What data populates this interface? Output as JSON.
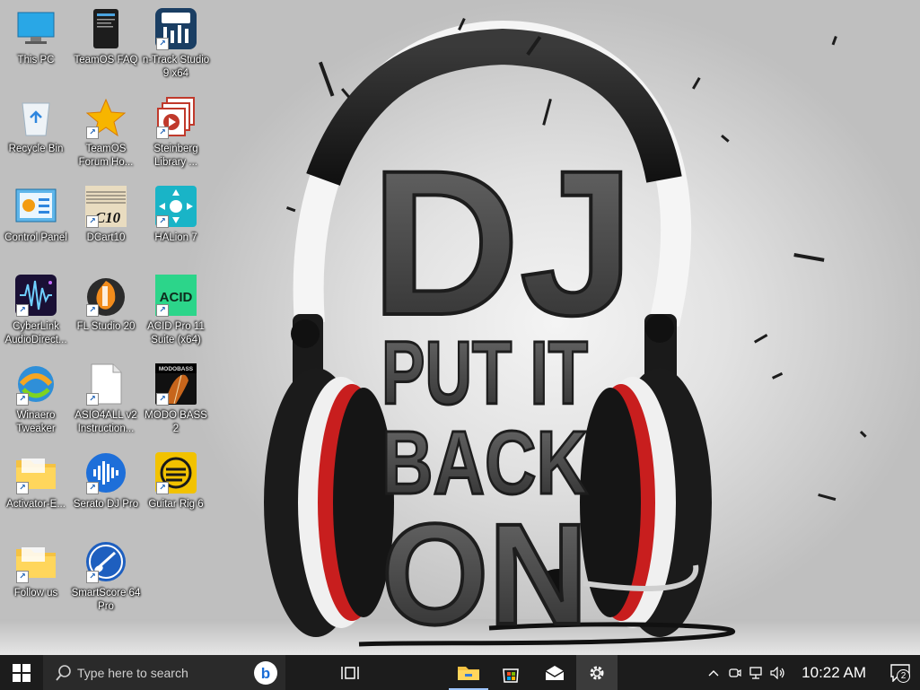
{
  "desktop": {
    "icons": [
      {
        "label": "This PC",
        "icon": "computer-icon"
      },
      {
        "label": "TeamOS FAQ",
        "icon": "document-icon"
      },
      {
        "label": "n-Track Studio 9 x64",
        "icon": "ntrack-icon"
      },
      {
        "label": "Recycle Bin",
        "icon": "recycle-bin-icon"
      },
      {
        "label": "TeamOS Forum Ho...",
        "icon": "star-icon"
      },
      {
        "label": "Steinberg Library ...",
        "icon": "steinberg-icon"
      },
      {
        "label": "Control Panel",
        "icon": "control-panel-icon"
      },
      {
        "label": "DCart10",
        "icon": "dcart-icon"
      },
      {
        "label": "HALion 7",
        "icon": "halion-icon"
      },
      {
        "label": "CyberLink AudioDirect...",
        "icon": "cyberlink-icon"
      },
      {
        "label": "FL Studio 20",
        "icon": "fl-studio-icon"
      },
      {
        "label": "ACID Pro 11 Suite (x64)",
        "icon": "acid-icon"
      },
      {
        "label": "Winaero Tweaker",
        "icon": "winaero-icon"
      },
      {
        "label": "ASIO4ALL v2 Instruction...",
        "icon": "blank-file-icon"
      },
      {
        "label": "MODO BASS 2",
        "icon": "modo-bass-icon"
      },
      {
        "label": "Activator-E...",
        "icon": "folder-icon"
      },
      {
        "label": "Serato DJ Pro",
        "icon": "serato-icon"
      },
      {
        "label": "Guitar Rig 6",
        "icon": "guitar-rig-icon"
      },
      {
        "label": "Follow us",
        "icon": "folder-icon"
      },
      {
        "label": "SmartScore 64 Pro",
        "icon": "smartscore-icon"
      }
    ],
    "modo_badge": "MODOBASS",
    "acid_text": "ACID",
    "dcart_text": "C10"
  },
  "wallpaper": {
    "line1": "DJ",
    "line2": "PUT IT",
    "line3": "BACK",
    "line4": "ON"
  },
  "taskbar": {
    "search_placeholder": "Type here to search",
    "apps": [
      "bing-icon",
      "task-view-icon",
      "file-explorer-icon",
      "store-icon",
      "mail-icon",
      "settings-icon"
    ],
    "clock": "10:22 AM",
    "notification_count": "2"
  },
  "colors": {
    "taskbar_bg": "#1c1c1c",
    "accent": "#9ec5ff",
    "headphone_red": "#c81e1e"
  }
}
